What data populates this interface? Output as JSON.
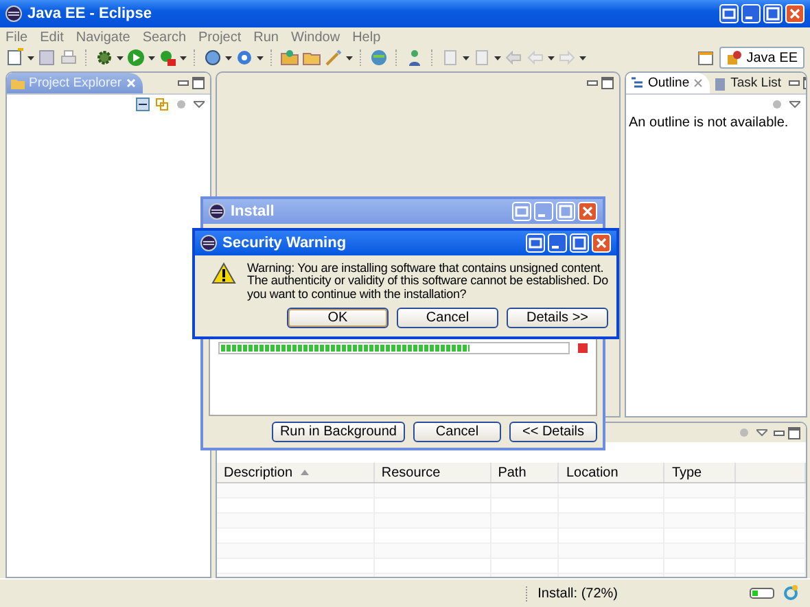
{
  "window": {
    "title": "Java EE - Eclipse"
  },
  "menu": [
    "File",
    "Edit",
    "Navigate",
    "Search",
    "Project",
    "Run",
    "Window",
    "Help"
  ],
  "perspective": {
    "label": "Java EE",
    "selected": true
  },
  "project_explorer": {
    "tab": "Project Explorer"
  },
  "outline": {
    "tabs": [
      {
        "label": "Outline",
        "selected": true
      },
      {
        "label": "Task List",
        "selected": false
      }
    ],
    "message": "An outline is not available."
  },
  "problems": {
    "columns": [
      {
        "label": "Description",
        "sorted": true
      },
      {
        "label": "Resource",
        "sorted": false
      },
      {
        "label": "Path",
        "sorted": false
      },
      {
        "label": "Location",
        "sorted": false
      },
      {
        "label": "Type",
        "sorted": false
      }
    ]
  },
  "install": {
    "title": "Install",
    "level": 0.72,
    "buttons": [
      "Run in Background",
      "Cancel",
      "<< Details"
    ]
  },
  "security_warning": {
    "title": "Security Warning",
    "message": "Warning: You are installing software that contains unsigned content. The authenticity or validity of this software cannot be established. Do you want to continue with the installation?",
    "buttons": [
      {
        "label": "OK",
        "default": true
      },
      {
        "label": "Cancel",
        "default": false
      },
      {
        "label": "Details >>",
        "default": false
      }
    ]
  },
  "status_bar": {
    "task": "Install: (72%)"
  }
}
